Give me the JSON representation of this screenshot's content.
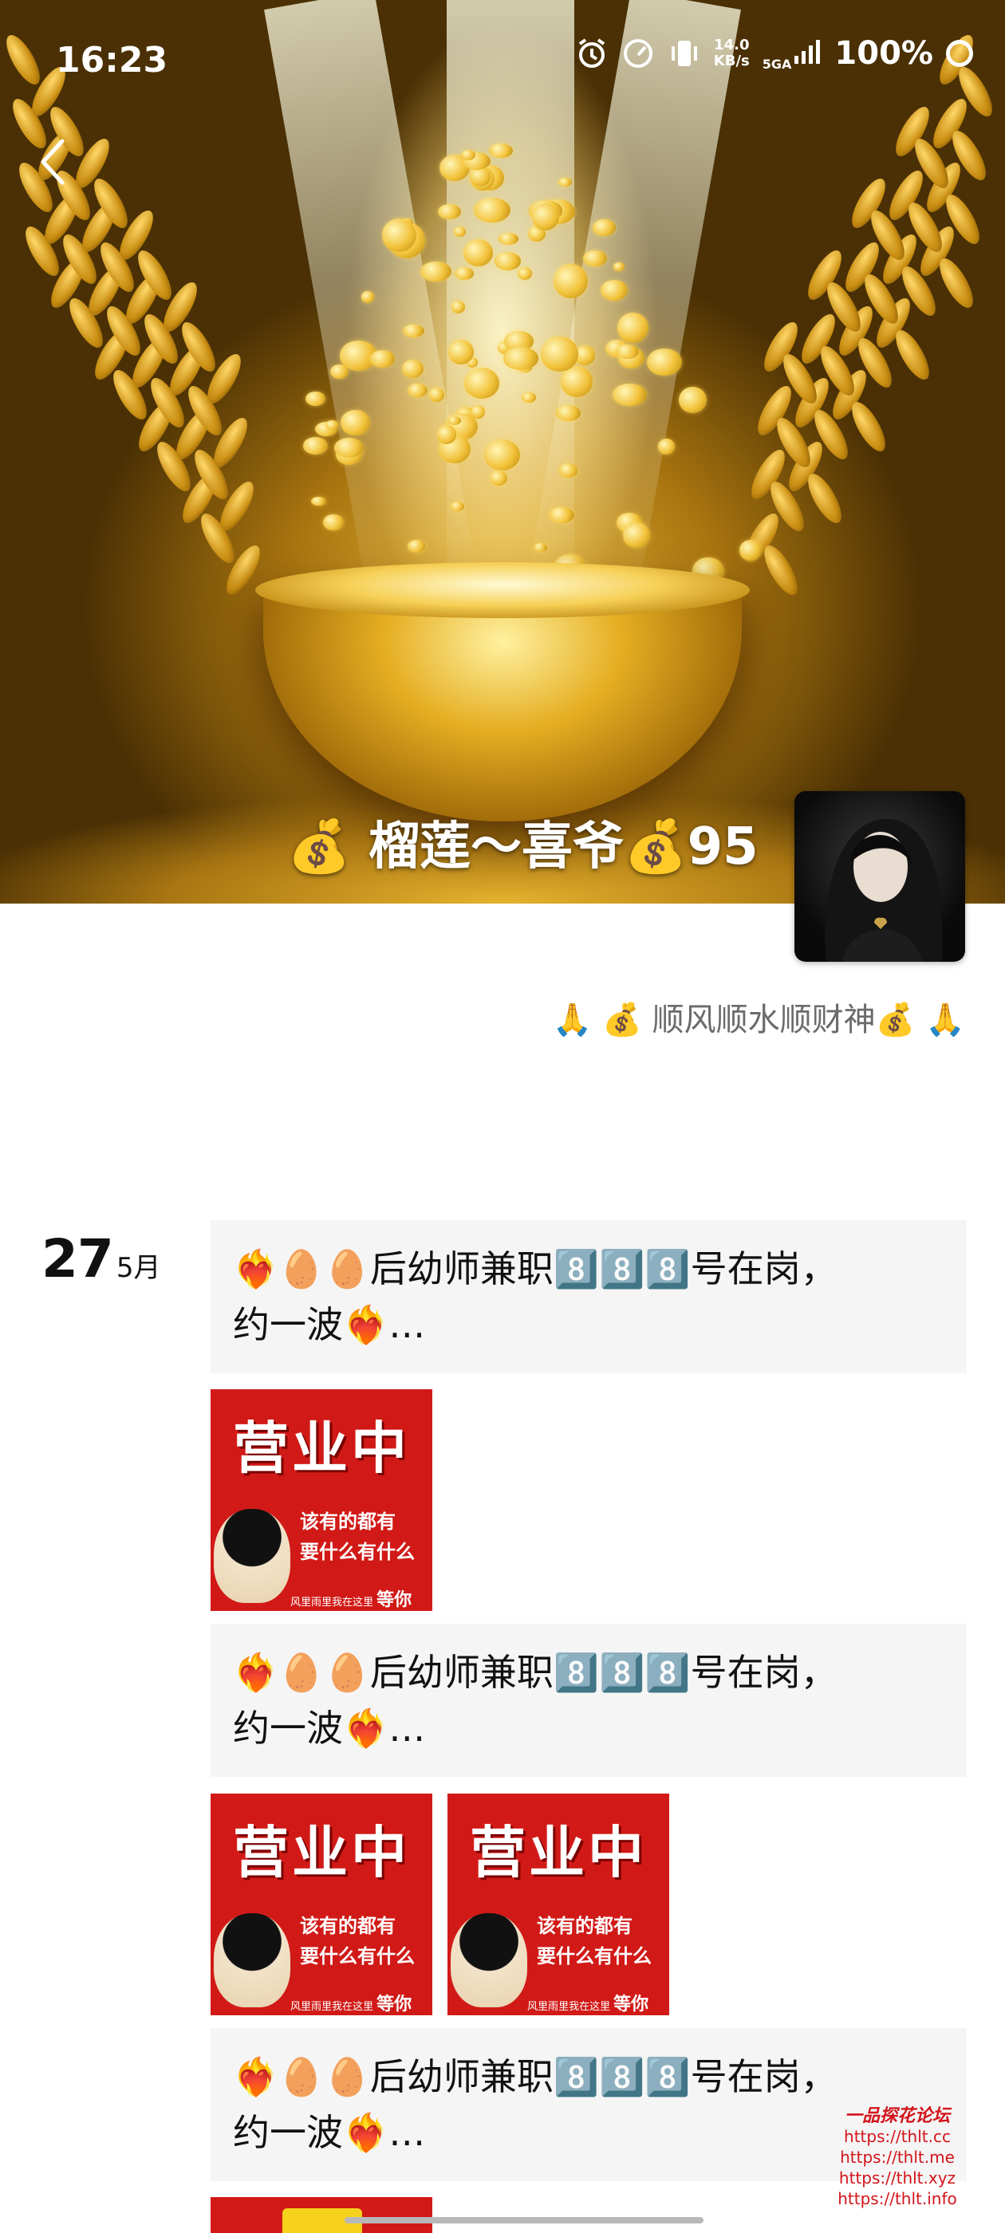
{
  "status_bar": {
    "time": "16:23",
    "net_speed_value": "14.0",
    "net_speed_unit": "KB/s",
    "network": "5GA",
    "battery": "100%",
    "icons": [
      "alarm-icon",
      "speedometer-icon",
      "vibrate-icon",
      "signal-icon",
      "battery-ring-icon"
    ]
  },
  "header": {
    "back_icon": "chevron-left-icon",
    "name": "💰 榴莲～喜爷💰95",
    "signature": "🙏 💰 顺风顺水顺财神💰 🙏"
  },
  "feed": {
    "date_day": "27",
    "date_month": "5月",
    "posts": [
      {
        "text_line1": "❤️‍🔥🥚🥚后幼师兼职8️⃣8️⃣8️⃣号在岗，",
        "text_line2": "约一波❤️‍🔥…"
      },
      {
        "text_line1": "❤️‍🔥🥚🥚后幼师兼职8️⃣8️⃣8️⃣号在岗，",
        "text_line2": "约一波❤️‍🔥…"
      },
      {
        "text_line1": "❤️‍🔥🥚🥚后幼师兼职8️⃣8️⃣8️⃣号在岗，",
        "text_line2": "约一波❤️‍🔥…"
      }
    ],
    "thumbnail": {
      "title": "营业中",
      "line1": "该有的都有",
      "line2": "要什么有什么",
      "foot_small": "风里雨里我在这里",
      "foot_big": "等你"
    }
  },
  "watermark": {
    "title": "一品探花论坛",
    "urls": [
      "https://thlt.cc",
      "https://thlt.me",
      "https://thlt.xyz",
      "https://thlt.info"
    ]
  }
}
